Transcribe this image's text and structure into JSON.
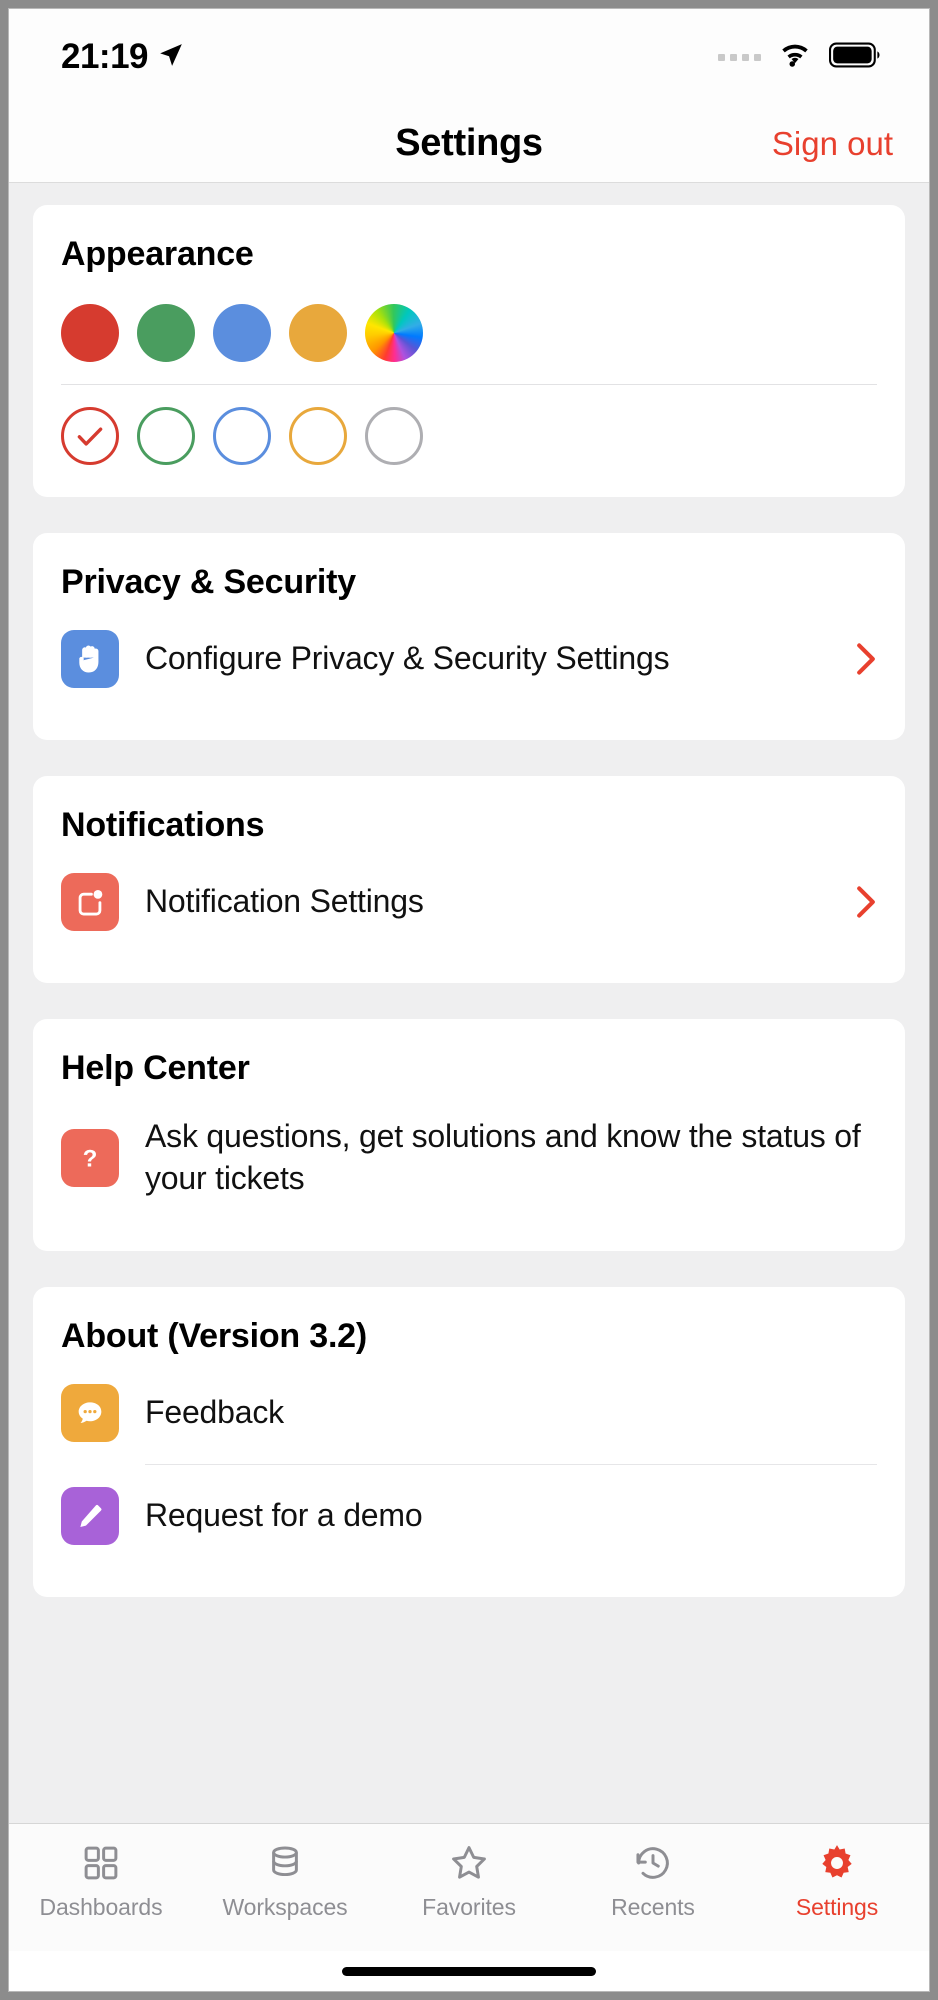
{
  "status_bar": {
    "time": "21:19",
    "location_icon": "location-arrow-icon",
    "cellular_icon": "cellular-dots-icon",
    "wifi_icon": "wifi-icon",
    "battery_icon": "battery-full-icon"
  },
  "nav": {
    "title": "Settings",
    "action_label": "Sign out",
    "action_color": "#e8402e"
  },
  "appearance": {
    "title": "Appearance",
    "swatches": [
      {
        "name": "red",
        "color": "#d63b2f"
      },
      {
        "name": "green",
        "color": "#4a9d5f"
      },
      {
        "name": "blue",
        "color": "#5b8ede"
      },
      {
        "name": "amber",
        "color": "#e8a83c"
      },
      {
        "name": "rainbow",
        "color": "rainbow"
      }
    ],
    "rings": [
      {
        "name": "red",
        "color": "#d63b2f",
        "selected": true
      },
      {
        "name": "green",
        "color": "#4a9d5f",
        "selected": false
      },
      {
        "name": "blue",
        "color": "#5b8ede",
        "selected": false
      },
      {
        "name": "amber",
        "color": "#e8a83c",
        "selected": false
      },
      {
        "name": "gray",
        "color": "#aeaeb2",
        "selected": false
      }
    ]
  },
  "privacy": {
    "title": "Privacy & Security",
    "row_label": "Configure Privacy & Security Settings",
    "icon": "hand-raised-icon",
    "icon_bg": "#5b8ede",
    "chevron": "chevron-right-icon"
  },
  "notifications": {
    "title": "Notifications",
    "row_label": "Notification Settings",
    "icon": "notification-badge-icon",
    "icon_bg": "#ed6a5a",
    "chevron": "chevron-right-icon"
  },
  "help": {
    "title": "Help Center",
    "row_label": "Ask questions, get solutions and know the status of your tickets",
    "icon": "question-mark-icon",
    "icon_bg": "#ed6a5a"
  },
  "about": {
    "title": "About (Version 3.2)",
    "items": [
      {
        "label": "Feedback",
        "icon": "chat-bubble-icon",
        "icon_bg": "#efa93c"
      },
      {
        "label": "Request for a demo",
        "icon": "pencil-icon",
        "icon_bg": "#a862d8"
      }
    ]
  },
  "tabbar": {
    "items": [
      {
        "label": "Dashboards",
        "icon": "grid-squares-icon",
        "active": false
      },
      {
        "label": "Workspaces",
        "icon": "database-stack-icon",
        "active": false
      },
      {
        "label": "Favorites",
        "icon": "star-icon",
        "active": false
      },
      {
        "label": "Recents",
        "icon": "clock-history-icon",
        "active": false
      },
      {
        "label": "Settings",
        "icon": "gear-icon",
        "active": true
      }
    ],
    "active_color": "#e8402e",
    "inactive_color": "#8e8e93"
  }
}
